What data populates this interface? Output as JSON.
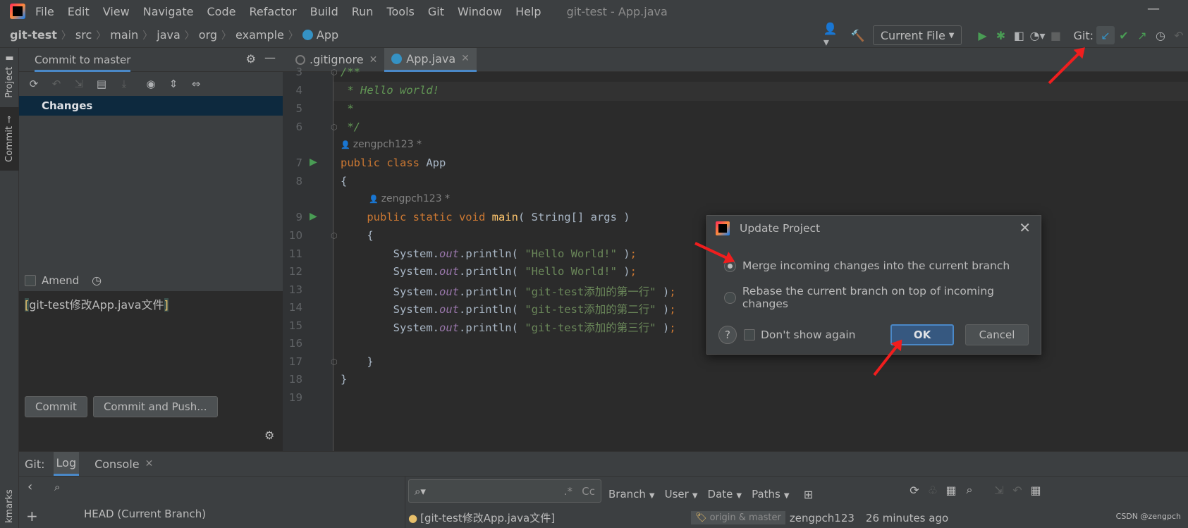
{
  "menubar": {
    "items": [
      "File",
      "Edit",
      "View",
      "Navigate",
      "Code",
      "Refactor",
      "Build",
      "Run",
      "Tools",
      "Git",
      "Window",
      "Help"
    ],
    "window_title": "git-test - App.java",
    "minimize": "—"
  },
  "navbar": {
    "breadcrumb": [
      "git-test",
      "src",
      "main",
      "java",
      "org",
      "example",
      "App"
    ],
    "run_config": "Current File",
    "git_label": "Git:"
  },
  "stripe": {
    "project": "Project",
    "commit": "Commit",
    "bookmarks": "kmarks"
  },
  "commit_panel": {
    "title": "Commit to master",
    "changes_node": "Changes",
    "amend_label": "Amend",
    "message_prefix": "[",
    "message_body": "git-test修改App.java文件",
    "message_suffix": "]",
    "commit_button": "Commit",
    "commit_push_button": "Commit and Push..."
  },
  "editor": {
    "tabs": [
      {
        "label": ".gitignore"
      },
      {
        "label": "App.java"
      }
    ],
    "line_numbers": [
      "3",
      "4",
      "5",
      "6",
      "7",
      "8",
      "9",
      "10",
      "11",
      "12",
      "13",
      "14",
      "15",
      "16",
      "17",
      "18",
      "19"
    ],
    "author_1": "zengpch123 *",
    "author_2": "zengpch123 *",
    "code": {
      "l3": "/**",
      "l4": " * Hello world!",
      "l5": " *",
      "l6": " */",
      "l7_kw": "public class ",
      "l7_name": "App",
      "l8": "{",
      "l9_kw": "    public static void ",
      "l9_fn": "main",
      "l9_rest": "( String[] args )",
      "l10": "    {",
      "print_prefix": "        System.",
      "print_field": "out",
      "print_method": ".println( ",
      "print_suffix": " )",
      "semicolon": ";",
      "s11": "\"Hello World!\"",
      "s12": "\"Hello World!\"",
      "s13": "\"git-test添加的第一行\"",
      "s14": "\"git-test添加的第二行\"",
      "s15": "\"git-test添加的第三行\"",
      "l17": "    }",
      "l18": "}"
    }
  },
  "dialog": {
    "title": "Update Project",
    "close": "✕",
    "option_merge": "Merge incoming changes into the current branch",
    "option_rebase": "Rebase the current branch on top of incoming changes",
    "selected_option": "merge",
    "help": "?",
    "dont_show_again": "Don't show again",
    "ok": "OK",
    "cancel": "Cancel"
  },
  "bottom_panel": {
    "git_label": "Git:",
    "tabs": [
      "Log",
      "Console"
    ],
    "branch_head": "HEAD (Current Branch)",
    "filters": [
      "Branch",
      "User",
      "Date",
      "Paths"
    ],
    "search_case": "Cc",
    "search_regex": ".*",
    "commit_message": "[git-test修改App.java文件]",
    "refs": "origin & master",
    "author": "zengpch123",
    "time": "26 minutes ago"
  },
  "watermark": "CSDN @zengpch",
  "colors": {
    "accent": "#4a88c7",
    "arrow": "#f01e1e",
    "run_green": "#499c54"
  }
}
